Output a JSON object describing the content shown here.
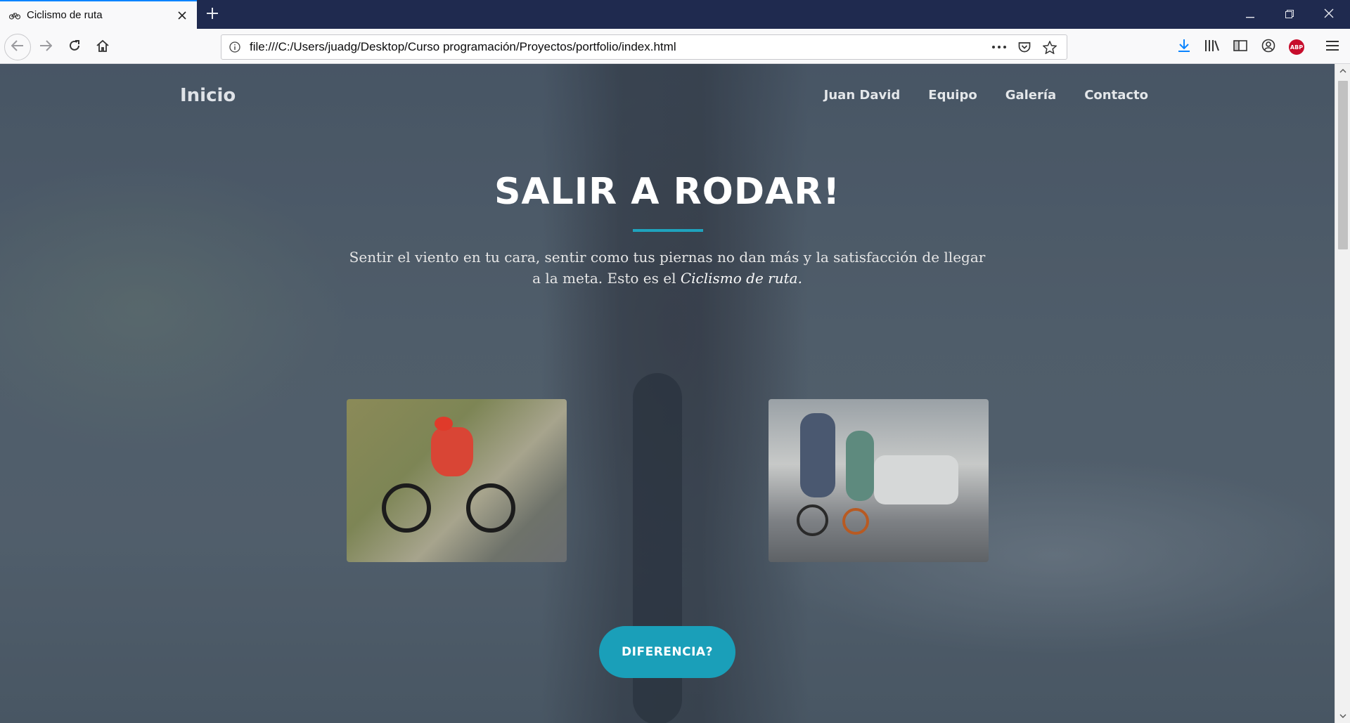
{
  "browser": {
    "tab_title": "Ciclismo de ruta",
    "url": "file:///C:/Users/juadg/Desktop/Curso programación/Proyectos/portfolio/index.html",
    "icons": {
      "favicon": "bicycle-icon",
      "close": "close-icon",
      "new_tab": "plus-icon",
      "back": "back-arrow-icon",
      "forward": "forward-arrow-icon",
      "reload": "reload-icon",
      "home": "home-icon",
      "info": "info-icon",
      "more": "ellipsis-icon",
      "pocket": "pocket-icon",
      "bookmark": "star-icon",
      "downloads": "download-icon",
      "library": "library-icon",
      "sidebar": "sidebar-icon",
      "account": "account-icon",
      "adblock": "abp-icon",
      "menu": "hamburger-icon"
    },
    "adblock_label": "ABP",
    "accent_color": "#0a84ff"
  },
  "page": {
    "brand": "Inicio",
    "nav": [
      "Juan David",
      "Equipo",
      "Galería",
      "Contacto"
    ],
    "hero": {
      "title": "SALIR A RODAR!",
      "text_plain": "Sentir el viento en tu cara, sentir como tus piernas no dan más y la satisfacción de llegar a la meta. Esto es el ",
      "text_em": "Ciclismo de ruta."
    },
    "cta_label": "DIFERENCIA?",
    "accent_color": "#1a9fb9"
  }
}
